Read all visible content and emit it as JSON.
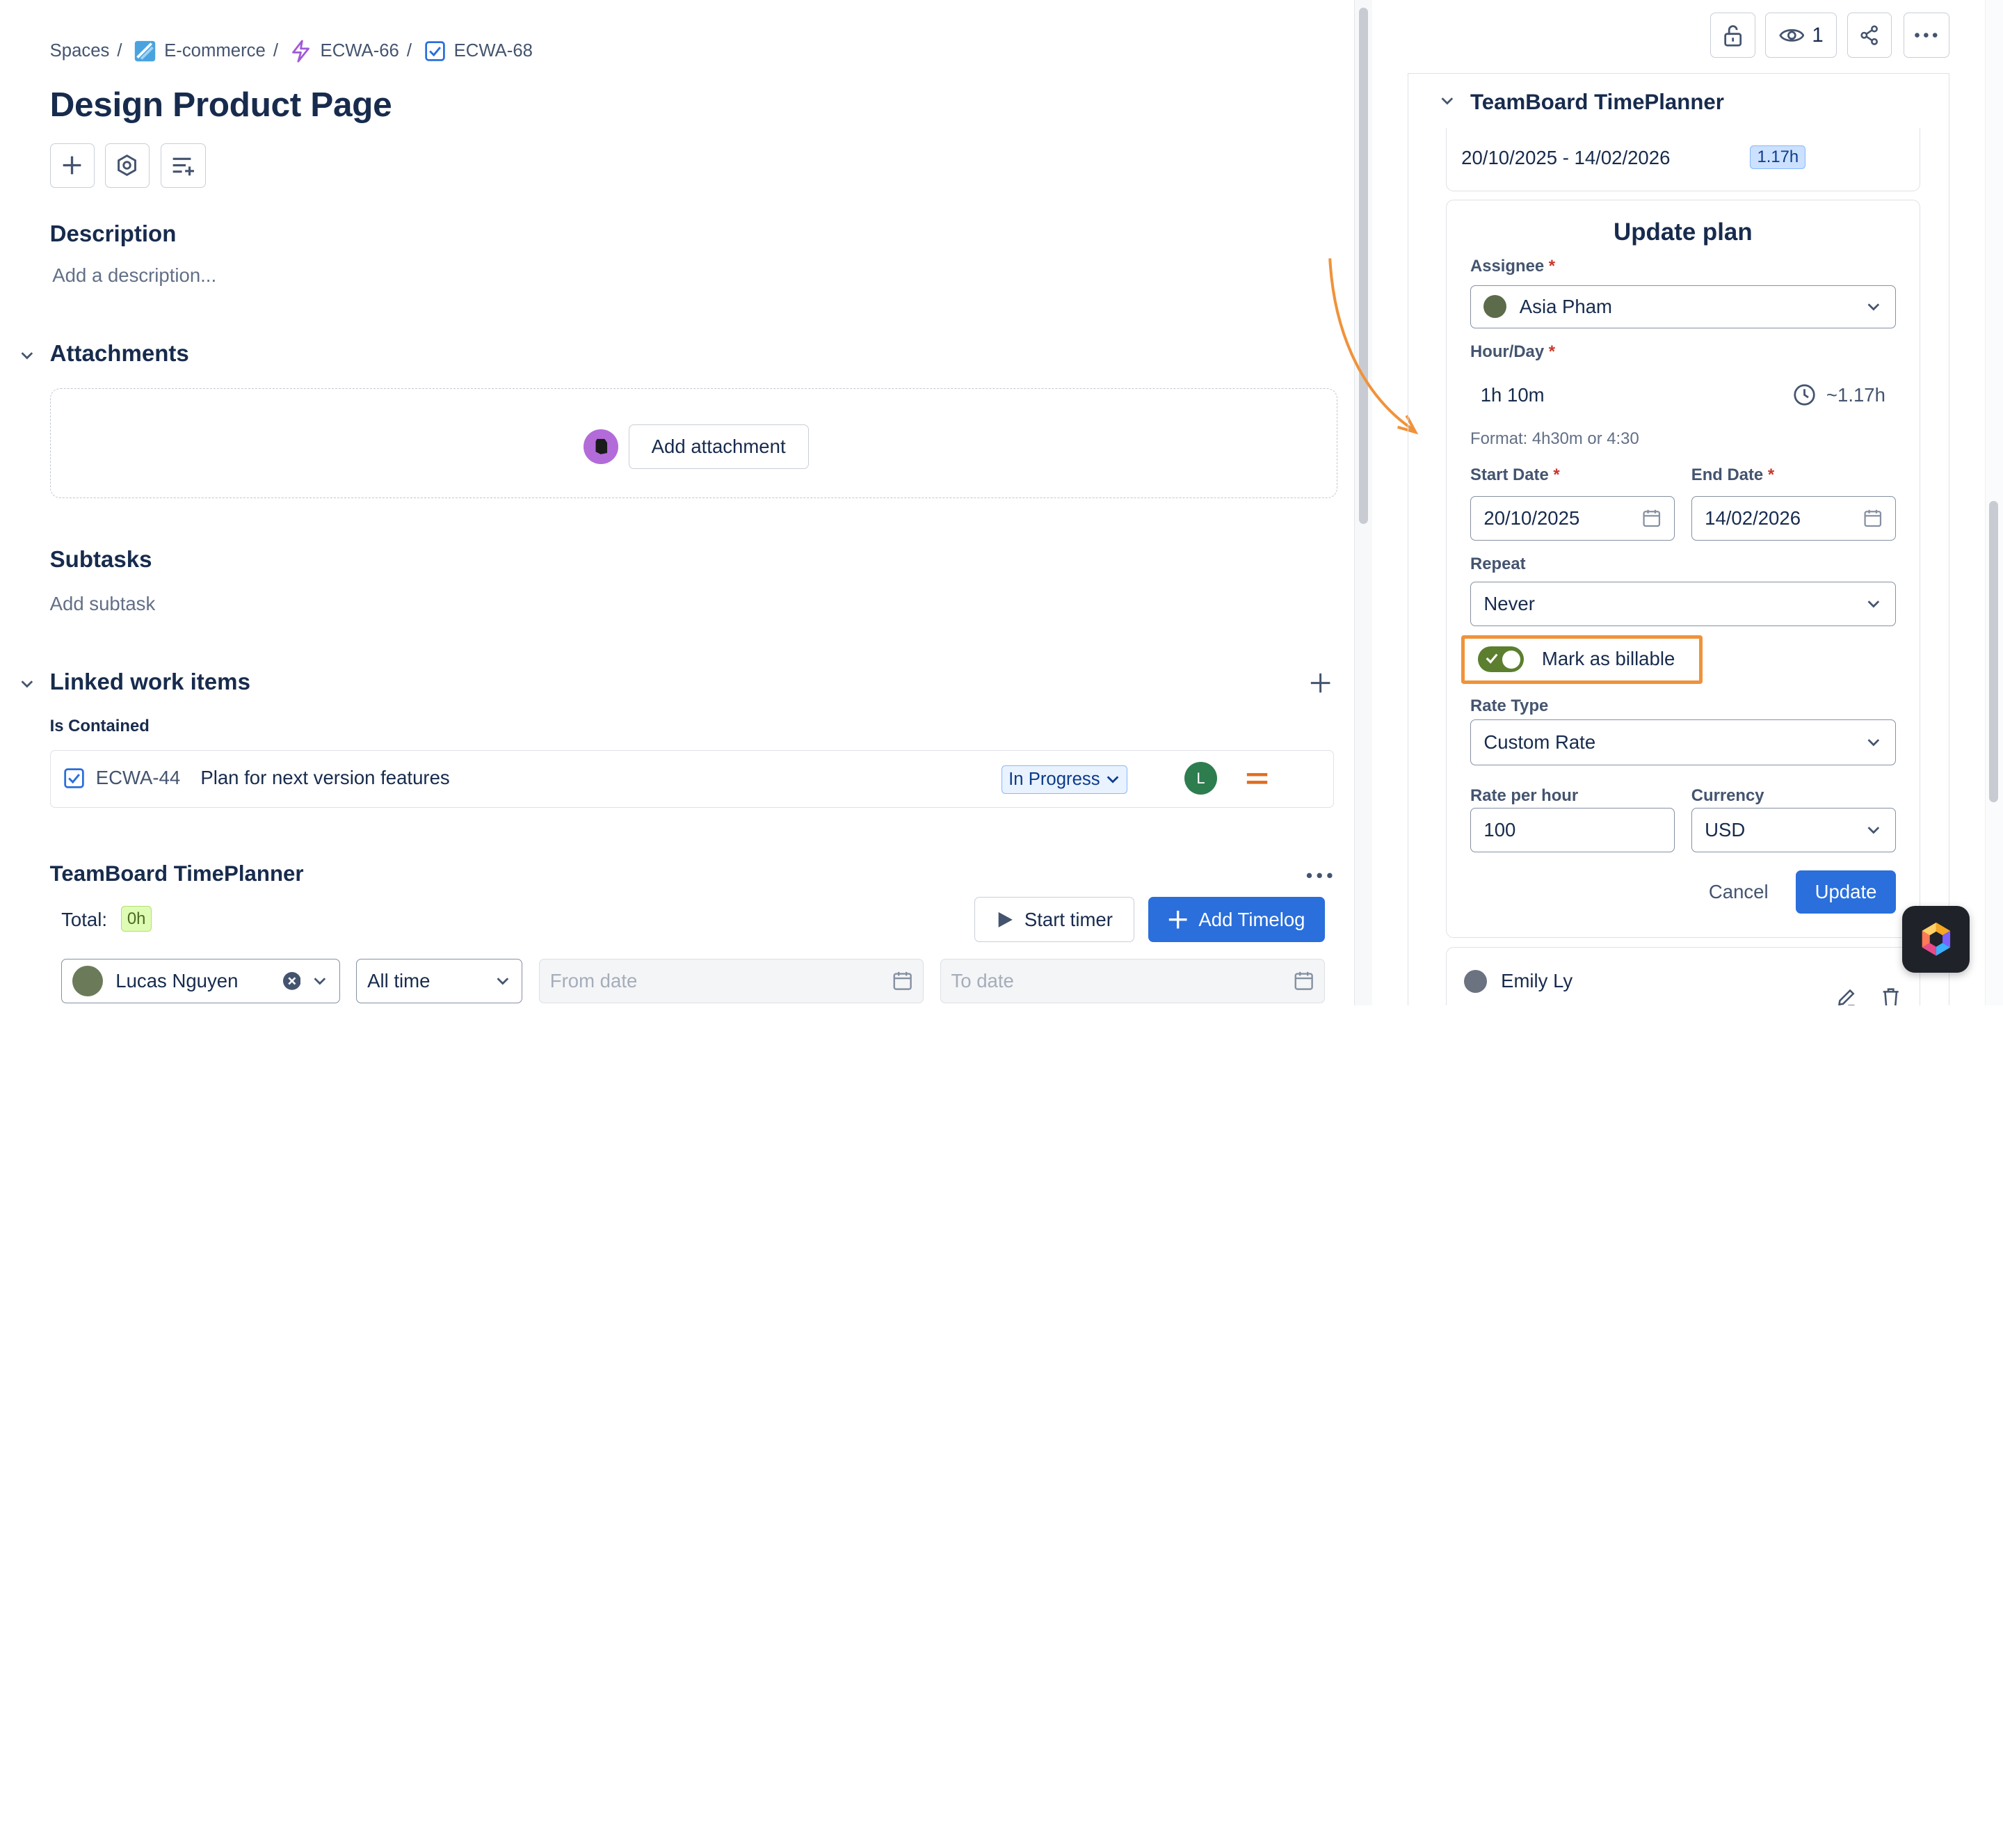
{
  "breadcrumb": {
    "items": [
      {
        "label": "Spaces",
        "icon": "none"
      },
      {
        "label": "E-commerce",
        "icon": "project-icon"
      },
      {
        "label": "ECWA-66",
        "icon": "epic-lightning-icon"
      },
      {
        "label": "ECWA-68",
        "icon": "task-check-icon"
      }
    ],
    "separator": "/"
  },
  "issue": {
    "title": "Design Product Page"
  },
  "description": {
    "heading": "Description",
    "placeholder": "Add a description..."
  },
  "attachments": {
    "heading": "Attachments",
    "add_label": "Add attachment"
  },
  "subtasks": {
    "heading": "Subtasks",
    "add_label": "Add subtask"
  },
  "linked": {
    "heading": "Linked work items",
    "group_label": "Is Contained",
    "item": {
      "key": "ECWA-44",
      "summary": "Plan for next version features",
      "status": "In Progress",
      "assignee_initial": "L",
      "priority": "medium"
    }
  },
  "timeplanner_main": {
    "heading": "TeamBoard TimePlanner",
    "total_label": "Total:",
    "total_value": "0h",
    "start_timer": "Start timer",
    "add_timelog": "Add Timelog",
    "filter_user": "Lucas Nguyen",
    "filter_range": "All time",
    "from_placeholder": "From date",
    "to_placeholder": "To date"
  },
  "right_toolbar": {
    "watchers": "1"
  },
  "side_panel": {
    "heading": "TeamBoard TimePlanner",
    "plan_range": "20/10/2025 - 14/02/2026",
    "plan_hours": "1.17h",
    "form": {
      "title": "Update plan",
      "assignee_label": "Assignee",
      "assignee_value": "Asia Pham",
      "hourday_label": "Hour/Day",
      "hourday_value": "1h 10m",
      "hourday_calc": "~1.17h",
      "format_hint": "Format: 4h30m or 4:30",
      "start_label": "Start Date",
      "start_value": "20/10/2025",
      "end_label": "End Date",
      "end_value": "14/02/2026",
      "repeat_label": "Repeat",
      "repeat_value": "Never",
      "billable_label": "Mark as billable",
      "billable_on": true,
      "rate_type_label": "Rate Type",
      "rate_type_value": "Custom Rate",
      "rate_label": "Rate per hour",
      "rate_value": "100",
      "currency_label": "Currency",
      "currency_value": "USD",
      "cancel": "Cancel",
      "update": "Update",
      "required_mark": "*"
    },
    "next_user": "Emily Ly"
  },
  "colors": {
    "accent": "#2a6fdb",
    "highlight": "#f0923a",
    "toggle_on": "#5b7f2e"
  }
}
